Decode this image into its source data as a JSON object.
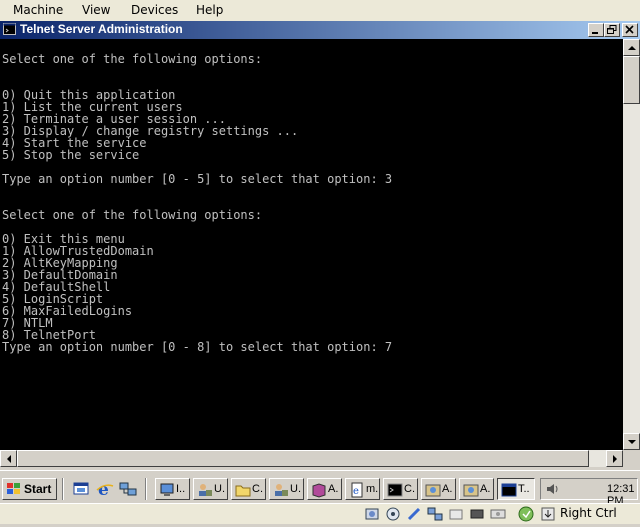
{
  "vm_menu": {
    "items": [
      "Machine",
      "View",
      "Devices",
      "Help"
    ]
  },
  "window": {
    "title": "Telnet Server Administration",
    "buttons": [
      "minimize-icon",
      "restore-icon",
      "close-icon"
    ]
  },
  "console": {
    "lines": [
      "Select one of the following options:",
      "",
      "",
      "0) Quit this application",
      "1) List the current users",
      "2) Terminate a user session ...",
      "3) Display / change registry settings ...",
      "4) Start the service",
      "5) Stop the service",
      "",
      "Type an option number [0 - 5] to select that option: 3",
      "",
      "",
      "Select one of the following options:",
      "",
      "0) Exit this menu",
      "1) AllowTrustedDomain",
      "2) AltKeyMapping",
      "3) DefaultDomain",
      "4) DefaultShell",
      "5) LoginScript",
      "6) MaxFailedLogins",
      "7) NTLM",
      "8) TelnetPort",
      "Type an option number [0 - 8] to select that option: 7"
    ],
    "colors": {
      "background": "#000000",
      "text": "#c0c0c0"
    }
  },
  "taskbar": {
    "start_label": "Start",
    "quick_launch": [
      "show-desktop-icon",
      "internet-explorer-icon",
      "network-icon"
    ],
    "tasks": [
      {
        "label": "I..",
        "icon": "computer-icon",
        "active": false
      },
      {
        "label": "U.",
        "icon": "users-icon",
        "active": false
      },
      {
        "label": "C.",
        "icon": "folder-icon",
        "active": false
      },
      {
        "label": "U.",
        "icon": "users-icon",
        "active": false
      },
      {
        "label": "A.",
        "icon": "book-icon",
        "active": false
      },
      {
        "label": "m.",
        "icon": "document-icon",
        "active": false
      },
      {
        "label": "C.",
        "icon": "command-prompt-icon",
        "active": false
      },
      {
        "label": "A.",
        "icon": "admin-tool-icon",
        "active": false
      },
      {
        "label": "A.",
        "icon": "admin-tool-icon",
        "active": false
      },
      {
        "label": "T..",
        "icon": "telnet-icon",
        "active": true
      }
    ],
    "tray": {
      "clock": "12:31 PM",
      "icons": [
        "volume-icon"
      ]
    }
  },
  "status_bar": {
    "icons": [
      "hard-disk-icon",
      "optical-drive-icon",
      "usb-icon",
      "network-adapter-icon",
      "shared-folder-icon",
      "display-icon",
      "video-capture-icon",
      "mouse-integration-icon",
      "keyboard-arrow-icon"
    ],
    "host_key": "Right Ctrl"
  },
  "colors": {
    "title_gradient_start": "#0a246a",
    "title_gradient_end": "#a6caf0",
    "face": "#d4d0c8"
  }
}
